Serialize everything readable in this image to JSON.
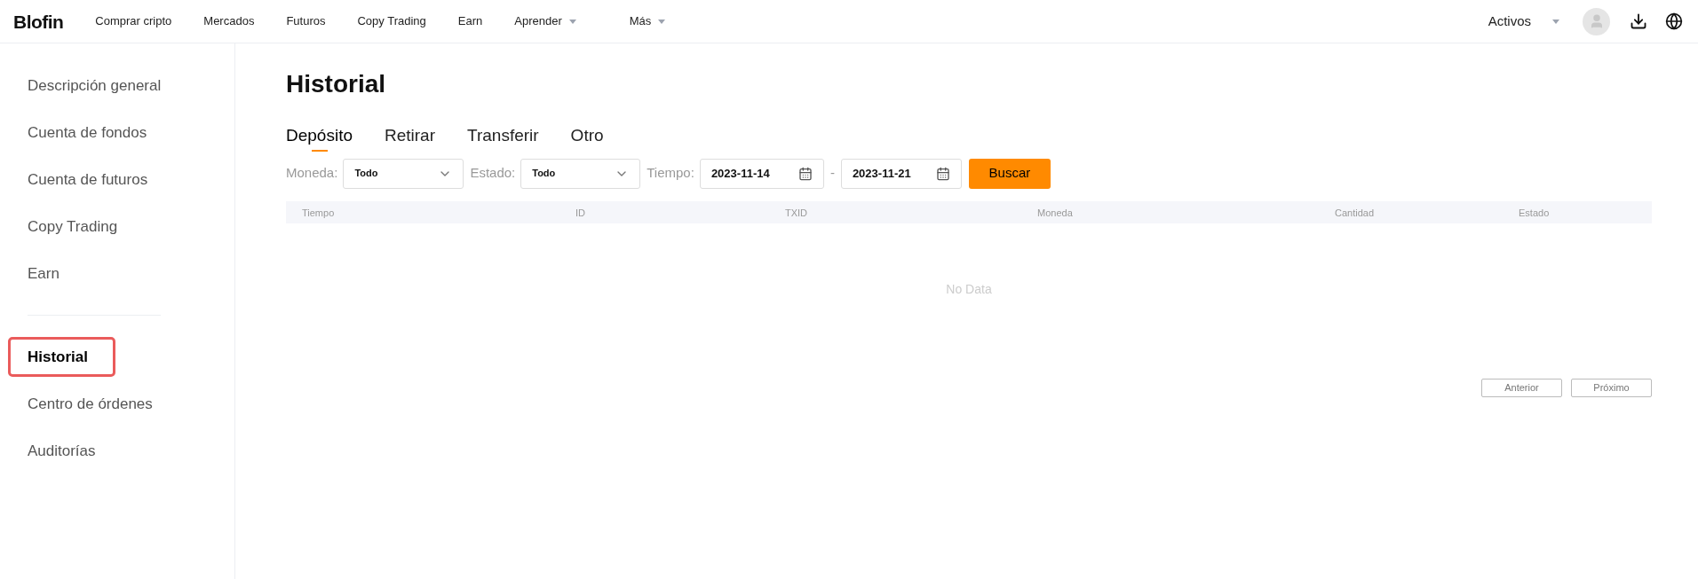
{
  "header": {
    "logo": "Blofin",
    "nav": [
      {
        "label": "Comprar cripto",
        "dropdown": false
      },
      {
        "label": "Mercados",
        "dropdown": false
      },
      {
        "label": "Futuros",
        "dropdown": false
      },
      {
        "label": "Copy Trading",
        "dropdown": false
      },
      {
        "label": "Earn",
        "dropdown": false
      },
      {
        "label": "Aprender",
        "dropdown": true
      },
      {
        "label": "Más",
        "dropdown": true
      }
    ],
    "assets": "Activos"
  },
  "sidebar": {
    "groups": [
      [
        {
          "label": "Descripción general",
          "selected": false
        },
        {
          "label": "Cuenta de fondos",
          "selected": false
        },
        {
          "label": "Cuenta de futuros",
          "selected": false
        },
        {
          "label": "Copy Trading",
          "selected": false
        },
        {
          "label": "Earn",
          "selected": false
        }
      ],
      [
        {
          "label": "Historial",
          "selected": true
        },
        {
          "label": "Centro de órdenes",
          "selected": false
        },
        {
          "label": "Auditorías",
          "selected": false
        }
      ]
    ]
  },
  "page": {
    "title": "Historial",
    "tabs": [
      {
        "label": "Depósito",
        "selected": true
      },
      {
        "label": "Retirar",
        "selected": false
      },
      {
        "label": "Transferir",
        "selected": false
      },
      {
        "label": "Otro",
        "selected": false
      }
    ],
    "filters": {
      "currency_label": "Moneda:",
      "currency_value": "Todo",
      "status_label": "Estado:",
      "status_value": "Todo",
      "time_label": "Tiempo:",
      "date_from": "2023-11-14",
      "date_separator": "-",
      "date_to": "2023-11-21",
      "search_button": "Buscar"
    },
    "table": {
      "columns": [
        "Tiempo",
        "ID",
        "TXID",
        "Moneda",
        "Cantidad",
        "Estado"
      ],
      "empty_text": "No Data"
    },
    "pagination": {
      "previous": "Anterior",
      "next": "Próximo"
    }
  }
}
